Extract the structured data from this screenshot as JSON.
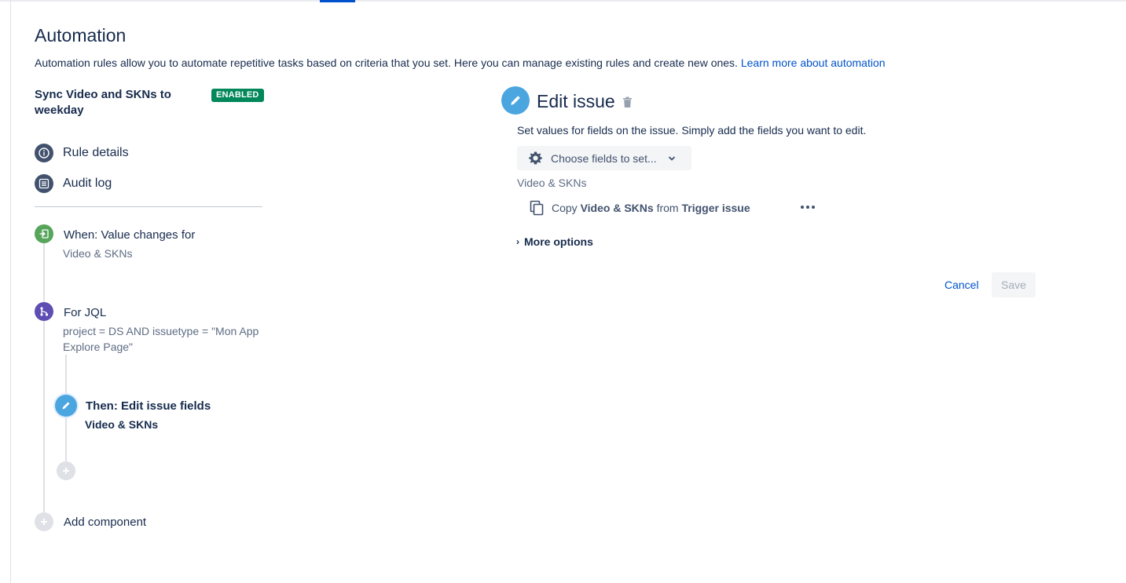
{
  "page": {
    "title": "Automation",
    "description": "Automation rules allow you to automate repetitive tasks based on criteria that you set. Here you can manage existing rules and create new ones.",
    "learn_more_link": "Learn more about automation"
  },
  "rule": {
    "name": "Sync Video and SKNs to weekday",
    "status_badge": "ENABLED"
  },
  "sidebar_nav": [
    {
      "label": "Rule details",
      "icon": "info-icon"
    },
    {
      "label": "Audit log",
      "icon": "list-icon"
    }
  ],
  "steps": {
    "trigger": {
      "title": "When: Value changes for",
      "subtitle": "Video & SKNs",
      "color": "#57a55a",
      "icon": "trigger-icon"
    },
    "branch": {
      "title": "For JQL",
      "subtitle": "project = DS AND issuetype = \"Mon App Explore Page\"",
      "color": "#5e4db2",
      "icon": "branch-icon"
    },
    "action": {
      "title": "Then: Edit issue fields",
      "subtitle": "Video & SKNs",
      "color": "#4ba6e0",
      "icon": "pencil-icon"
    },
    "add_component_label": "Add component"
  },
  "editor": {
    "title": "Edit issue",
    "description": "Set values for fields on the issue. Simply add the fields you want to edit.",
    "choose_fields_label": "Choose fields to set...",
    "field_label": "Video & SKNs",
    "copy_row": {
      "prefix": "Copy",
      "field": "Video & SKNs",
      "middle": "from",
      "source": "Trigger issue"
    },
    "more_options_label": "More options",
    "cancel_label": "Cancel",
    "save_label": "Save"
  },
  "colors": {
    "accent": "#0052cc",
    "enabled_badge": "#00875a",
    "edit_icon": "#4ba6e0"
  }
}
